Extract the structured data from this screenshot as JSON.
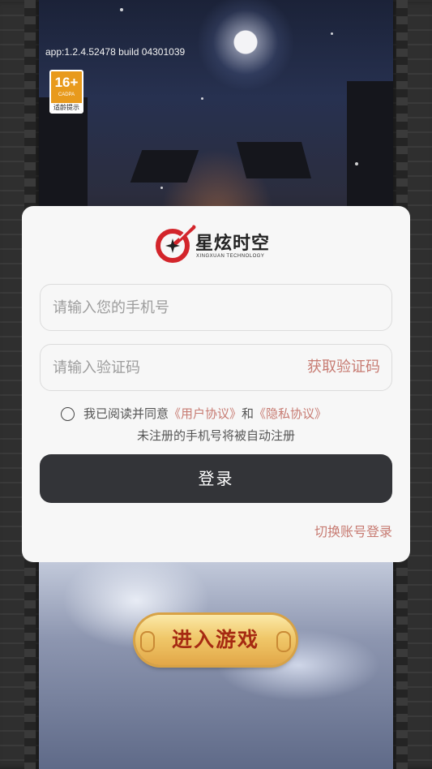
{
  "app_version": "app:1.2.4.52478 build 04301039",
  "age_rating": {
    "number": "16+",
    "org": "CADPA",
    "tip": "适龄提示"
  },
  "brand": {
    "name": "星炫时空",
    "subtitle": "XINGXUAN TECHNOLOGY",
    "accent_color": "#d3252b"
  },
  "login_form": {
    "phone_placeholder": "请输入您的手机号",
    "code_placeholder": "请输入验证码",
    "get_code_label": "获取验证码",
    "agree_prefix": "我已阅读并同意",
    "user_agreement": "《用户协议》",
    "agree_and": "和",
    "privacy_policy": "《隐私协议》",
    "auto_register_note": "未注册的手机号将被自动注册",
    "login_button": "登录",
    "switch_login": "切换账号登录",
    "link_color": "#c77b72"
  },
  "enter_game_button": "进入游戏"
}
